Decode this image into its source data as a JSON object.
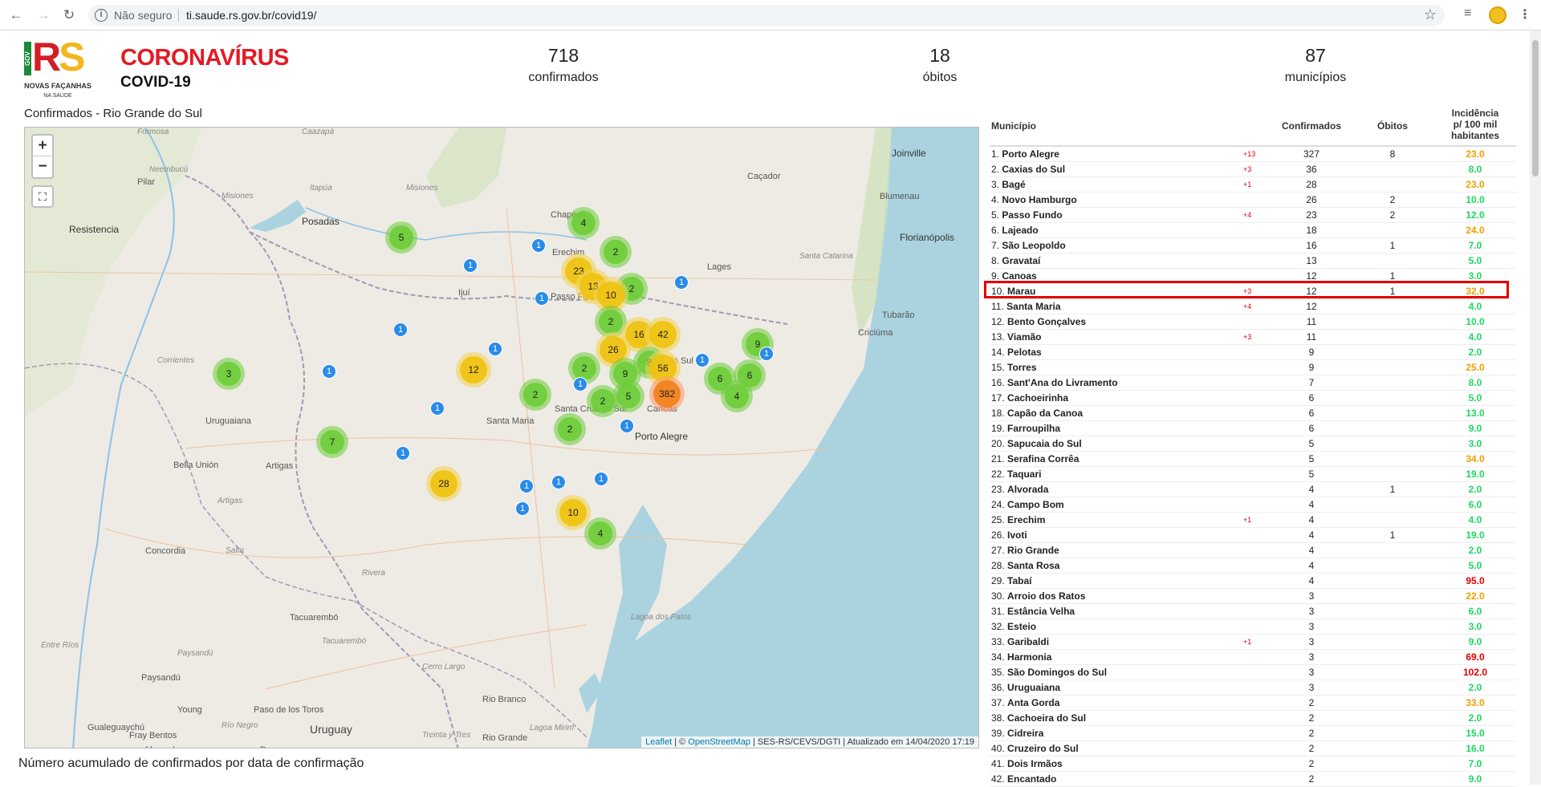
{
  "browser": {
    "security_label": "Não seguro",
    "url": "ti.saude.rs.gov.br/covid19/"
  },
  "header": {
    "logo_gov": "GOV",
    "logo_r": "R",
    "logo_s": "S",
    "logo_slogan": "NOVAS FAÇANHAS",
    "logo_slogan_sub": "NA SAÚDE",
    "brand_title": "CORONAVÍRUS",
    "brand_subtitle": "COVID-19"
  },
  "stats": [
    {
      "value": "718",
      "label": "confirmados"
    },
    {
      "value": "18",
      "label": "óbitos"
    },
    {
      "value": "87",
      "label": "municípios"
    }
  ],
  "map": {
    "title": "Confirmados - Rio Grande do Sul",
    "zoom_in": "+",
    "zoom_out": "−",
    "attribution_leaflet": "Leaflet",
    "attribution_osm": "OpenStreetMap",
    "attribution_rest": "| SES-RS/CEVS/DGTI | Atualizado em 14/04/2020 17:19",
    "places": [
      {
        "name": "Formosa",
        "cls": "it"
      },
      {
        "name": "Caazapá",
        "cls": "it"
      },
      {
        "name": "Neembucú",
        "cls": "it"
      },
      {
        "name": "Itapúa",
        "cls": "it"
      },
      {
        "name": "Misiones",
        "cls": "it"
      },
      {
        "name": "Pilar",
        "cls": ""
      },
      {
        "name": "Resistencia",
        "cls": "city"
      },
      {
        "name": "Posadas",
        "cls": "city"
      },
      {
        "name": "Misiones",
        "cls": "it"
      },
      {
        "name": "Chapecó",
        "cls": ""
      },
      {
        "name": "Caçador",
        "cls": ""
      },
      {
        "name": "Joinville",
        "cls": "city"
      },
      {
        "name": "Blumenau",
        "cls": ""
      },
      {
        "name": "Florianópolis",
        "cls": "city"
      },
      {
        "name": "Santa Catarina",
        "cls": "it"
      },
      {
        "name": "Lages",
        "cls": ""
      },
      {
        "name": "Tubarão",
        "cls": ""
      },
      {
        "name": "Criciúma",
        "cls": ""
      },
      {
        "name": "Erechim",
        "cls": ""
      },
      {
        "name": "Passo Fundo",
        "cls": ""
      },
      {
        "name": "Ijuí",
        "cls": ""
      },
      {
        "name": "Corrientes",
        "cls": "it"
      },
      {
        "name": "Caxias do Sul",
        "cls": ""
      },
      {
        "name": "Uruguaiana",
        "cls": ""
      },
      {
        "name": "Santa Maria",
        "cls": ""
      },
      {
        "name": "Santa Cruz do Sul",
        "cls": ""
      },
      {
        "name": "Canoas",
        "cls": ""
      },
      {
        "name": "Porto Alegre",
        "cls": "city"
      },
      {
        "name": "Bella Unión",
        "cls": ""
      },
      {
        "name": "Artigas",
        "cls": ""
      },
      {
        "name": "Artigas",
        "cls": "it"
      },
      {
        "name": "Concordia",
        "cls": ""
      },
      {
        "name": "Salto",
        "cls": "it"
      },
      {
        "name": "Rivera",
        "cls": "it"
      },
      {
        "name": "Tacuarembó",
        "cls": ""
      },
      {
        "name": "Entre Ríos",
        "cls": "it"
      },
      {
        "name": "Paysandú",
        "cls": "it"
      },
      {
        "name": "Tacuarembó",
        "cls": "it"
      },
      {
        "name": "Paysandú",
        "cls": ""
      },
      {
        "name": "Cerro Largo",
        "cls": "it"
      },
      {
        "name": "Lagoa dos Patos",
        "cls": "it"
      },
      {
        "name": "Rio Branco",
        "cls": ""
      },
      {
        "name": "Rio Grande",
        "cls": ""
      },
      {
        "name": "Young",
        "cls": ""
      },
      {
        "name": "Paso de los Toros",
        "cls": ""
      },
      {
        "name": "Río Negro",
        "cls": "it"
      },
      {
        "name": "Gualeguaychú",
        "cls": ""
      },
      {
        "name": "Fray Bentos",
        "cls": ""
      },
      {
        "name": "Uruguay",
        "cls": "big"
      },
      {
        "name": "Mercedes",
        "cls": ""
      },
      {
        "name": "Durazno",
        "cls": ""
      },
      {
        "name": "Lagoa Mirim",
        "cls": "it"
      },
      {
        "name": "Treinta y Tres",
        "cls": "it"
      }
    ],
    "clusters": [
      {
        "count": "5",
        "color": "green"
      },
      {
        "count": "4",
        "color": "green"
      },
      {
        "count": "2",
        "color": "green"
      },
      {
        "count": "23",
        "color": "yellow"
      },
      {
        "count": "13",
        "color": "yellow"
      },
      {
        "count": "2",
        "color": "green"
      },
      {
        "count": "10",
        "color": "yellow"
      },
      {
        "count": "2",
        "color": "green"
      },
      {
        "count": "16",
        "color": "yellow"
      },
      {
        "count": "42",
        "color": "yellow"
      },
      {
        "count": "26",
        "color": "yellow"
      },
      {
        "count": "9",
        "color": "green"
      },
      {
        "count": "3",
        "color": "green"
      },
      {
        "count": "12",
        "color": "yellow"
      },
      {
        "count": "8",
        "color": "green"
      },
      {
        "count": "2",
        "color": "green"
      },
      {
        "count": "9",
        "color": "green"
      },
      {
        "count": "56",
        "color": "yellow"
      },
      {
        "count": "6",
        "color": "green"
      },
      {
        "count": "6",
        "color": "green"
      },
      {
        "count": "2",
        "color": "green"
      },
      {
        "count": "2",
        "color": "green"
      },
      {
        "count": "5",
        "color": "green"
      },
      {
        "count": "382",
        "color": "orange"
      },
      {
        "count": "4",
        "color": "green"
      },
      {
        "count": "2",
        "color": "green"
      },
      {
        "count": "7",
        "color": "green"
      },
      {
        "count": "28",
        "color": "yellow"
      },
      {
        "count": "10",
        "color": "yellow"
      },
      {
        "count": "4",
        "color": "green"
      }
    ],
    "pins": [
      "1",
      "1",
      "1",
      "1",
      "1",
      "1",
      "1",
      "1",
      "1",
      "1",
      "1",
      "1",
      "1",
      "1",
      "1",
      "1",
      "1"
    ]
  },
  "chart_section": {
    "title": "Número acumulado de confirmados por data de confirmação"
  },
  "table": {
    "headers": {
      "municipio": "Município",
      "confirmados": "Confirmados",
      "obitos": "Óbitos",
      "incidencia_1": "Incidência",
      "incidencia_2": "p/ 100 mil",
      "incidencia_3": "habitantes"
    },
    "highlighted_row": "10. Marau",
    "colors": {
      "low": "#1ed760",
      "mid": "#f0a000",
      "high": "#e00000"
    },
    "rows": [
      {
        "rank": "1.",
        "name": "Porto Alegre",
        "delta": "+13",
        "conf": "327",
        "obit": "8",
        "inc": "23.0",
        "level": "mid"
      },
      {
        "rank": "2.",
        "name": "Caxias do Sul",
        "delta": "+3",
        "conf": "36",
        "obit": "",
        "inc": "8.0",
        "level": "low"
      },
      {
        "rank": "3.",
        "name": "Bagé",
        "delta": "+1",
        "conf": "28",
        "obit": "",
        "inc": "23.0",
        "level": "mid"
      },
      {
        "rank": "4.",
        "name": "Novo Hamburgo",
        "delta": "",
        "conf": "26",
        "obit": "2",
        "inc": "10.0",
        "level": "low"
      },
      {
        "rank": "5.",
        "name": "Passo Fundo",
        "delta": "+4",
        "conf": "23",
        "obit": "2",
        "inc": "12.0",
        "level": "low"
      },
      {
        "rank": "6.",
        "name": "Lajeado",
        "delta": "",
        "conf": "18",
        "obit": "",
        "inc": "24.0",
        "level": "mid"
      },
      {
        "rank": "7.",
        "name": "São Leopoldo",
        "delta": "",
        "conf": "16",
        "obit": "1",
        "inc": "7.0",
        "level": "low"
      },
      {
        "rank": "8.",
        "name": "Gravataí",
        "delta": "",
        "conf": "13",
        "obit": "",
        "inc": "5.0",
        "level": "low"
      },
      {
        "rank": "9.",
        "name": "Canoas",
        "delta": "",
        "conf": "12",
        "obit": "1",
        "inc": "3.0",
        "level": "low"
      },
      {
        "rank": "10.",
        "name": "Marau",
        "delta": "+3",
        "conf": "12",
        "obit": "1",
        "inc": "32.0",
        "level": "mid"
      },
      {
        "rank": "11.",
        "name": "Santa Maria",
        "delta": "+4",
        "conf": "12",
        "obit": "",
        "inc": "4.0",
        "level": "low"
      },
      {
        "rank": "12.",
        "name": "Bento Gonçalves",
        "delta": "",
        "conf": "11",
        "obit": "",
        "inc": "10.0",
        "level": "low"
      },
      {
        "rank": "13.",
        "name": "Viamão",
        "delta": "+3",
        "conf": "11",
        "obit": "",
        "inc": "4.0",
        "level": "low"
      },
      {
        "rank": "14.",
        "name": "Pelotas",
        "delta": "",
        "conf": "9",
        "obit": "",
        "inc": "2.0",
        "level": "low"
      },
      {
        "rank": "15.",
        "name": "Torres",
        "delta": "",
        "conf": "9",
        "obit": "",
        "inc": "25.0",
        "level": "mid"
      },
      {
        "rank": "16.",
        "name": "Sant'Ana do Livramento",
        "delta": "",
        "conf": "7",
        "obit": "",
        "inc": "8.0",
        "level": "low"
      },
      {
        "rank": "17.",
        "name": "Cachoeirinha",
        "delta": "",
        "conf": "6",
        "obit": "",
        "inc": "5.0",
        "level": "low"
      },
      {
        "rank": "18.",
        "name": "Capão da Canoa",
        "delta": "",
        "conf": "6",
        "obit": "",
        "inc": "13.0",
        "level": "low"
      },
      {
        "rank": "19.",
        "name": "Farroupilha",
        "delta": "",
        "conf": "6",
        "obit": "",
        "inc": "9.0",
        "level": "low"
      },
      {
        "rank": "20.",
        "name": "Sapucaia do Sul",
        "delta": "",
        "conf": "5",
        "obit": "",
        "inc": "3.0",
        "level": "low"
      },
      {
        "rank": "21.",
        "name": "Serafina Corrêa",
        "delta": "",
        "conf": "5",
        "obit": "",
        "inc": "34.0",
        "level": "mid"
      },
      {
        "rank": "22.",
        "name": "Taquari",
        "delta": "",
        "conf": "5",
        "obit": "",
        "inc": "19.0",
        "level": "low"
      },
      {
        "rank": "23.",
        "name": "Alvorada",
        "delta": "",
        "conf": "4",
        "obit": "1",
        "inc": "2.0",
        "level": "low"
      },
      {
        "rank": "24.",
        "name": "Campo Bom",
        "delta": "",
        "conf": "4",
        "obit": "",
        "inc": "6.0",
        "level": "low"
      },
      {
        "rank": "25.",
        "name": "Erechim",
        "delta": "+1",
        "conf": "4",
        "obit": "",
        "inc": "4.0",
        "level": "low"
      },
      {
        "rank": "26.",
        "name": "Ivoti",
        "delta": "",
        "conf": "4",
        "obit": "1",
        "inc": "19.0",
        "level": "low"
      },
      {
        "rank": "27.",
        "name": "Rio Grande",
        "delta": "",
        "conf": "4",
        "obit": "",
        "inc": "2.0",
        "level": "low"
      },
      {
        "rank": "28.",
        "name": "Santa Rosa",
        "delta": "",
        "conf": "4",
        "obit": "",
        "inc": "5.0",
        "level": "low"
      },
      {
        "rank": "29.",
        "name": "Tabaí",
        "delta": "",
        "conf": "4",
        "obit": "",
        "inc": "95.0",
        "level": "high"
      },
      {
        "rank": "30.",
        "name": "Arroio dos Ratos",
        "delta": "",
        "conf": "3",
        "obit": "",
        "inc": "22.0",
        "level": "mid"
      },
      {
        "rank": "31.",
        "name": "Estância Velha",
        "delta": "",
        "conf": "3",
        "obit": "",
        "inc": "6.0",
        "level": "low"
      },
      {
        "rank": "32.",
        "name": "Esteio",
        "delta": "",
        "conf": "3",
        "obit": "",
        "inc": "3.0",
        "level": "low"
      },
      {
        "rank": "33.",
        "name": "Garibaldi",
        "delta": "+1",
        "conf": "3",
        "obit": "",
        "inc": "9.0",
        "level": "low"
      },
      {
        "rank": "34.",
        "name": "Harmonia",
        "delta": "",
        "conf": "3",
        "obit": "",
        "inc": "69.0",
        "level": "high"
      },
      {
        "rank": "35.",
        "name": "São Domingos do Sul",
        "delta": "",
        "conf": "3",
        "obit": "",
        "inc": "102.0",
        "level": "high"
      },
      {
        "rank": "36.",
        "name": "Uruguaiana",
        "delta": "",
        "conf": "3",
        "obit": "",
        "inc": "2.0",
        "level": "low"
      },
      {
        "rank": "37.",
        "name": "Anta Gorda",
        "delta": "",
        "conf": "2",
        "obit": "",
        "inc": "33.0",
        "level": "mid"
      },
      {
        "rank": "38.",
        "name": "Cachoeira do Sul",
        "delta": "",
        "conf": "2",
        "obit": "",
        "inc": "2.0",
        "level": "low"
      },
      {
        "rank": "39.",
        "name": "Cidreira",
        "delta": "",
        "conf": "2",
        "obit": "",
        "inc": "15.0",
        "level": "low"
      },
      {
        "rank": "40.",
        "name": "Cruzeiro do Sul",
        "delta": "",
        "conf": "2",
        "obit": "",
        "inc": "16.0",
        "level": "low"
      },
      {
        "rank": "41.",
        "name": "Dois Irmãos",
        "delta": "",
        "conf": "2",
        "obit": "",
        "inc": "7.0",
        "level": "low"
      },
      {
        "rank": "42.",
        "name": "Encantado",
        "delta": "",
        "conf": "2",
        "obit": "",
        "inc": "9.0",
        "level": "low"
      }
    ]
  }
}
